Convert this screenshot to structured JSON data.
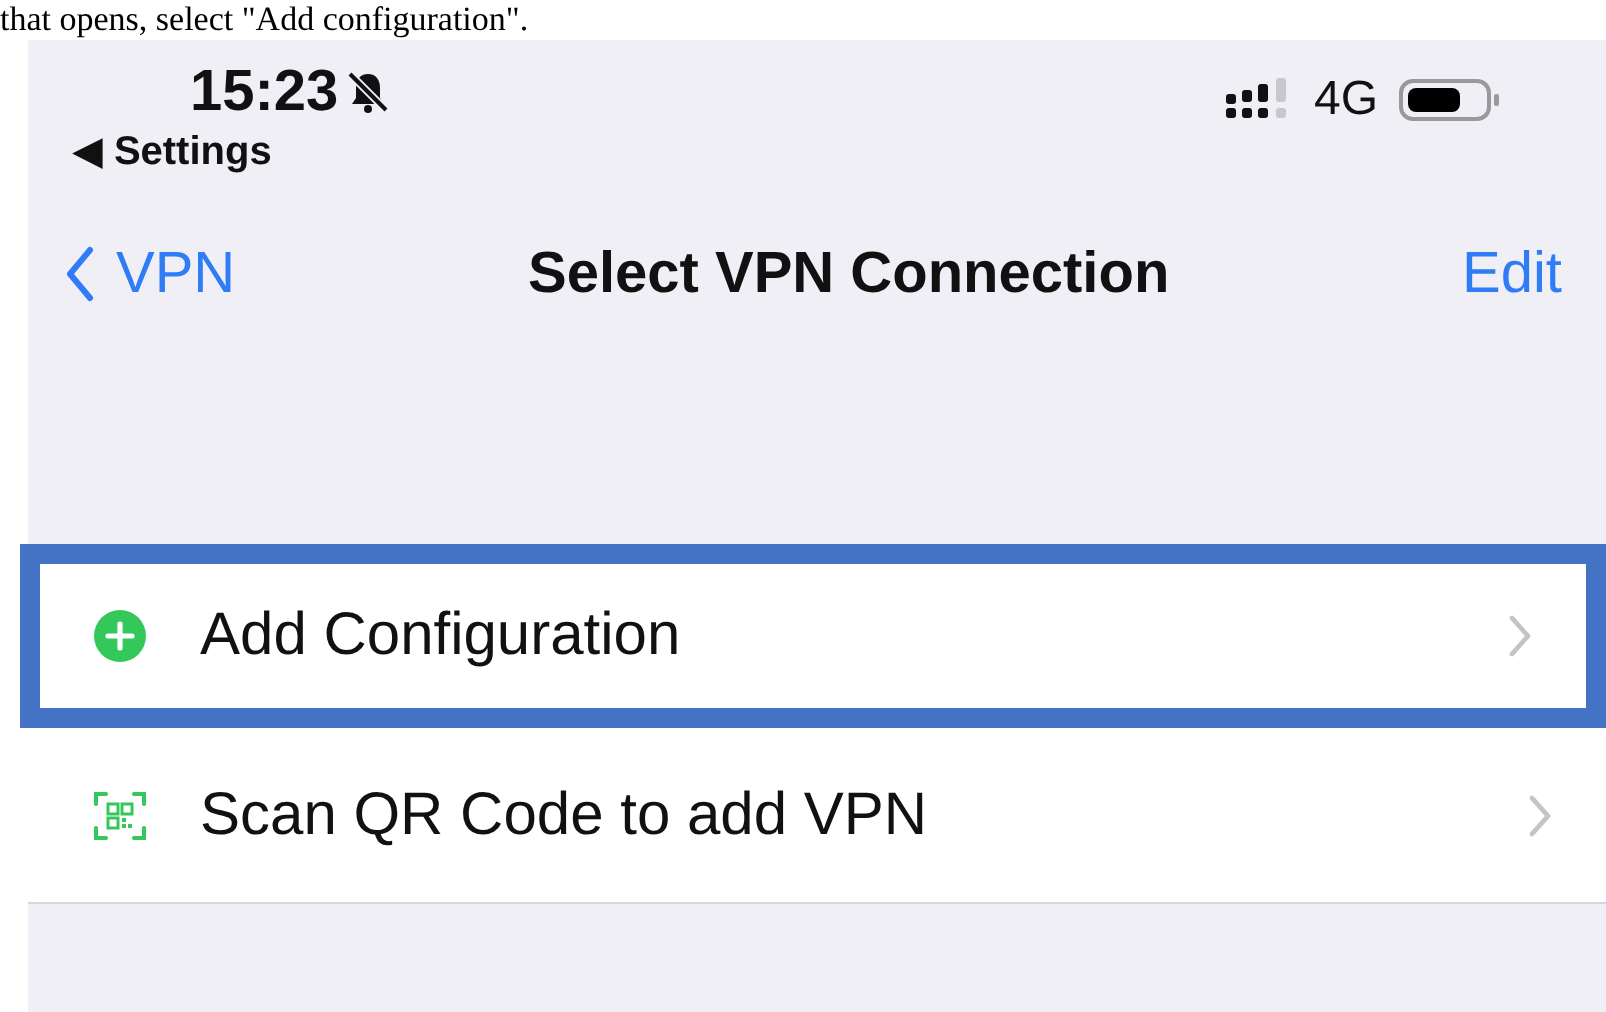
{
  "caption": "that opens, select \"Add configuration\".",
  "status_bar": {
    "time": "15:23",
    "silent": true,
    "back_label": "◀ Settings",
    "network": "4G"
  },
  "nav": {
    "back": "VPN",
    "title": "Select VPN Connection",
    "action": "Edit"
  },
  "rows": [
    {
      "kind": "add",
      "label": "Add Configuration",
      "highlighted": true
    },
    {
      "kind": "qr",
      "label": "Scan QR Code to add VPN",
      "highlighted": false
    }
  ]
}
